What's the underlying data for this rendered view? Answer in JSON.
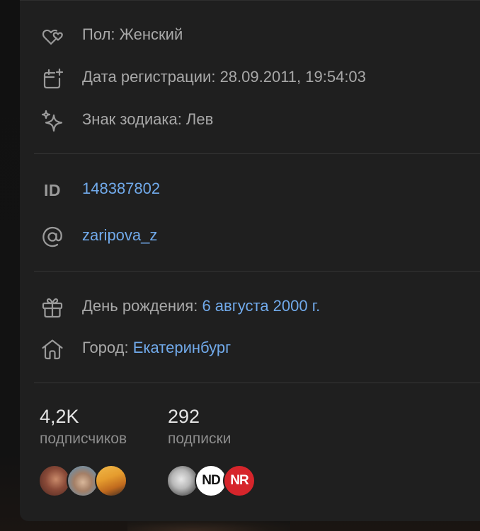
{
  "profile_details": {
    "gender": {
      "icon": "heart-outline-icon",
      "text": "Пол: Женский"
    },
    "registration": {
      "icon": "calendar-plus-icon",
      "text": "Дата регистрации: 28.09.2011, 19:54:03"
    },
    "zodiac": {
      "icon": "sparkles-icon",
      "text": "Знак зодиака: Лев"
    }
  },
  "identifiers": {
    "id_label": "ID",
    "id_value": "148387802",
    "username_icon": "at-sign-icon",
    "username": "zaripova_z"
  },
  "personal": {
    "birthday_icon": "gift-icon",
    "birthday_label": "День рождения: ",
    "birthday_value": "6 августа 2000 г.",
    "city_icon": "home-icon",
    "city_label": "Город: ",
    "city_value": "Екатеринбург"
  },
  "stats": {
    "followers_count": "4,2K",
    "followers_label": "подписчиков",
    "following_count": "292",
    "following_label": "подписки"
  },
  "following_avatars": [
    {
      "text": "ND"
    },
    {
      "text": "NR"
    }
  ],
  "colors": {
    "panel_bg": "#1f1f1f",
    "text_muted": "#a8a8a8",
    "link": "#71aaeb",
    "divider": "#363636",
    "nr_red": "#d6252b"
  }
}
